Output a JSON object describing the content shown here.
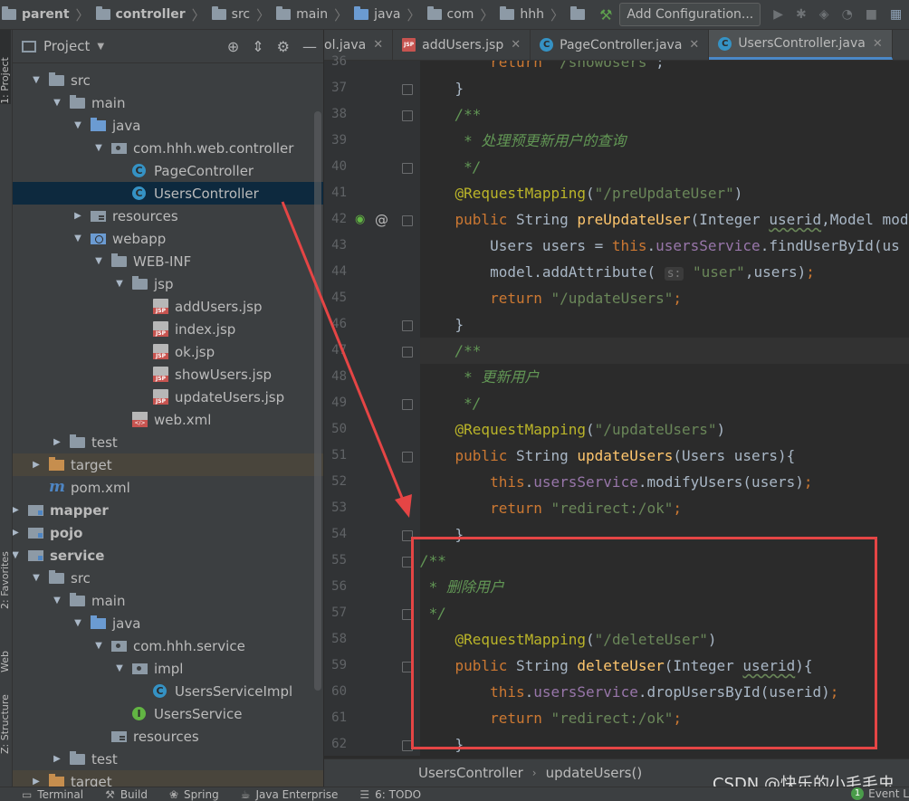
{
  "breadcrumbs": [
    "parent",
    "controller",
    "src",
    "main",
    "java",
    "com",
    "hhh"
  ],
  "toolbar": {
    "add_configuration": "Add Configuration..."
  },
  "left_strip": {
    "project": "1: Project",
    "favorites": "2: Favorites",
    "web": "Web",
    "structure": "Z: Structure"
  },
  "project_panel": {
    "title": "Project",
    "tree": [
      {
        "label": "src",
        "icon": "folder",
        "arrow": "down",
        "indent": 0
      },
      {
        "label": "main",
        "icon": "folder",
        "arrow": "down",
        "indent": 1
      },
      {
        "label": "java",
        "icon": "src",
        "arrow": "down",
        "indent": 2
      },
      {
        "label": "com.hhh.web.controller",
        "icon": "package",
        "arrow": "down",
        "indent": 3
      },
      {
        "label": "PageController",
        "icon": "class",
        "arrow": "",
        "indent": 4
      },
      {
        "label": "UsersController",
        "icon": "class",
        "arrow": "",
        "indent": 4,
        "selected": true
      },
      {
        "label": "resources",
        "icon": "resources",
        "arrow": "right",
        "indent": 2
      },
      {
        "label": "webapp",
        "icon": "web",
        "arrow": "down",
        "indent": 2
      },
      {
        "label": "WEB-INF",
        "icon": "folder",
        "arrow": "down",
        "indent": 3
      },
      {
        "label": "jsp",
        "icon": "folder",
        "arrow": "down",
        "indent": 4
      },
      {
        "label": "addUsers.jsp",
        "icon": "jsp",
        "arrow": "",
        "indent": 5
      },
      {
        "label": "index.jsp",
        "icon": "jsp",
        "arrow": "",
        "indent": 5
      },
      {
        "label": "ok.jsp",
        "icon": "jsp",
        "arrow": "",
        "indent": 5
      },
      {
        "label": "showUsers.jsp",
        "icon": "jsp",
        "arrow": "",
        "indent": 5
      },
      {
        "label": "updateUsers.jsp",
        "icon": "jsp",
        "arrow": "",
        "indent": 5
      },
      {
        "label": "web.xml",
        "icon": "xml",
        "arrow": "",
        "indent": 4
      },
      {
        "label": "test",
        "icon": "folder",
        "arrow": "right",
        "indent": 1
      },
      {
        "label": "target",
        "icon": "target",
        "arrow": "right",
        "indent": 0,
        "excluded": true
      },
      {
        "label": "pom.xml",
        "icon": "pom",
        "arrow": "",
        "indent": 0
      },
      {
        "label": "mapper",
        "icon": "module",
        "arrow": "right",
        "indent": -1,
        "bold": true
      },
      {
        "label": "pojo",
        "icon": "module",
        "arrow": "right",
        "indent": -1,
        "bold": true
      },
      {
        "label": "service",
        "icon": "module",
        "arrow": "down",
        "indent": -1,
        "bold": true
      },
      {
        "label": "src",
        "icon": "folder",
        "arrow": "down",
        "indent": 0
      },
      {
        "label": "main",
        "icon": "folder",
        "arrow": "down",
        "indent": 1
      },
      {
        "label": "java",
        "icon": "src",
        "arrow": "down",
        "indent": 2
      },
      {
        "label": "com.hhh.service",
        "icon": "package",
        "arrow": "down",
        "indent": 3
      },
      {
        "label": "impl",
        "icon": "package",
        "arrow": "down",
        "indent": 4
      },
      {
        "label": "UsersServiceImpl",
        "icon": "class",
        "arrow": "",
        "indent": 5
      },
      {
        "label": "UsersService",
        "icon": "interface",
        "arrow": "",
        "indent": 4
      },
      {
        "label": "resources",
        "icon": "resources",
        "arrow": "",
        "indent": 3
      },
      {
        "label": "test",
        "icon": "folder",
        "arrow": "right",
        "indent": 1
      },
      {
        "label": "target",
        "icon": "target",
        "arrow": "right",
        "indent": 0,
        "excluded": true
      }
    ]
  },
  "editor_tabs": [
    {
      "label": "ol.java",
      "icon": "class",
      "active": false
    },
    {
      "label": "addUsers.jsp",
      "icon": "jsp",
      "active": false
    },
    {
      "label": "PageController.java",
      "icon": "class",
      "active": false
    },
    {
      "label": "UsersController.java",
      "icon": "class",
      "active": true
    }
  ],
  "code_lines": [
    {
      "num": "36",
      "html": "        <span class=\"kw\">return</span> <span class=\"st\">\"/showUsers\"</span>;"
    },
    {
      "num": "37",
      "html": "    }"
    },
    {
      "num": "38",
      "html": "    <span class=\"cm\">/**</span>"
    },
    {
      "num": "39",
      "html": "<span class=\"cm\">     * 处理预更新用户的查询</span>"
    },
    {
      "num": "40",
      "html": "<span class=\"cm\">     */</span>"
    },
    {
      "num": "41",
      "html": "    <span class=\"an\">@RequestMapping</span>(<span class=\"st\">\"/preUpdateUser\"</span>)"
    },
    {
      "num": "42",
      "html": "    <span class=\"kw\">public</span> String <span class=\"fn\">preUpdateUser</span>(Integer <span class=\"wavy\">userid</span>,Model model"
    },
    {
      "num": "43",
      "html": "        Users users = <span class=\"kw\">this</span>.<span class=\"fd\">usersService</span>.findUserById(us"
    },
    {
      "num": "44",
      "html": "        model.addAttribute( <span class=\"hint\">s:</span> <span class=\"st\">\"user\"</span>,users)<span class=\"kw\">;</span>"
    },
    {
      "num": "45",
      "html": "        <span class=\"kw\">return</span> <span class=\"st\">\"/updateUsers\"</span><span class=\"kw\">;</span>"
    },
    {
      "num": "46",
      "html": "    }"
    },
    {
      "num": "47",
      "html": "    <span class=\"cm\">/**</span>",
      "current": true
    },
    {
      "num": "48",
      "html": "<span class=\"cm\">     * 更新用户</span>"
    },
    {
      "num": "49",
      "html": "<span class=\"cm\">     */</span>"
    },
    {
      "num": "50",
      "html": "    <span class=\"an\">@RequestMapping</span>(<span class=\"st\">\"/updateUsers\"</span>)"
    },
    {
      "num": "51",
      "html": "    <span class=\"kw\">public</span> String <span class=\"fn\">updateUsers</span>(Users users){"
    },
    {
      "num": "52",
      "html": "        <span class=\"kw\">this</span>.<span class=\"fd\">usersService</span>.modifyUsers(users)<span class=\"kw\">;</span>"
    },
    {
      "num": "53",
      "html": "        <span class=\"kw\">return</span> <span class=\"st\">\"redirect:/ok\"</span><span class=\"kw\">;</span>"
    },
    {
      "num": "54",
      "html": "    }"
    },
    {
      "num": "55",
      "html": "<span class=\"cm\">/**</span>"
    },
    {
      "num": "56",
      "html": "<span class=\"cm\"> * 删除用户</span>"
    },
    {
      "num": "57",
      "html": "<span class=\"cm\"> */</span>"
    },
    {
      "num": "58",
      "html": "    <span class=\"an\">@RequestMapping</span>(<span class=\"st\">\"/deleteUser\"</span>)"
    },
    {
      "num": "59",
      "html": "    <span class=\"kw\">public</span> String <span class=\"fn\">deleteUser</span>(Integer <span class=\"wavy\">userid</span>){"
    },
    {
      "num": "60",
      "html": "        <span class=\"kw\">this</span>.<span class=\"fd\">usersService</span>.dropUsersById(userid)<span class=\"kw\">;</span>"
    },
    {
      "num": "61",
      "html": "        <span class=\"kw\">return</span> <span class=\"st\">\"redirect:/ok\"</span><span class=\"kw\">;</span>"
    },
    {
      "num": "62",
      "html": "    }"
    }
  ],
  "editor_breadcrumb": {
    "class": "UsersController",
    "method": "updateUsers()"
  },
  "watermark": "CSDN @快乐的小毛毛虫",
  "statusbar": [
    {
      "label": "Terminal",
      "icon": "terminal-icon"
    },
    {
      "label": "Build",
      "icon": "hammer-icon"
    },
    {
      "label": "Spring",
      "icon": "spring-icon"
    },
    {
      "label": "Java Enterprise",
      "icon": "java-ee-icon"
    },
    {
      "label": "6: TODO",
      "icon": "todo-icon"
    }
  ],
  "event_log": {
    "count": "1",
    "label": "Event L"
  }
}
